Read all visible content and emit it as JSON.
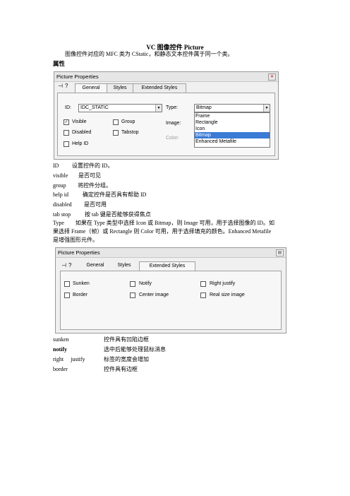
{
  "doc": {
    "title": "VC 图像控件 Picture",
    "intro": "图像控件对应的 MFC 类为 CStatic，和静态文本控件属于同一个类。",
    "section_heading": "属性"
  },
  "dialog1": {
    "title": "Picture Properties",
    "tabs": [
      "General",
      "Styles",
      "Extended Styles"
    ],
    "id_label": "ID:",
    "id_value": "IDC_STATIC",
    "type_label": "Type:",
    "type_value": "Bitmap",
    "type_options": [
      "Frame",
      "Rectangle",
      "Icon",
      "Bitmap",
      "Enhanced Metafile"
    ],
    "type_selected": "Bitmap",
    "image_label": "Image:",
    "color_label": "Color:",
    "checkboxes": {
      "visible": {
        "label": "Visible",
        "checked": true
      },
      "group": {
        "label": "Group",
        "checked": false
      },
      "disabled": {
        "label": "Disabled",
        "checked": false
      },
      "tabstop": {
        "label": "Tabstop",
        "checked": false
      },
      "help_id": {
        "label": "Help ID",
        "checked": false
      }
    }
  },
  "defs1": [
    {
      "term": "ID",
      "desc": "设置控件的 ID。"
    },
    {
      "term": "visible",
      "desc": "是否可见"
    },
    {
      "term": "group",
      "desc": "将控件分组。"
    },
    {
      "term": "help id",
      "desc": "确定控件是否具有帮助 ID"
    },
    {
      "term": "disabled",
      "desc": "是否可用"
    },
    {
      "term": "tab stop",
      "desc": "按 tab 键是否能够获得焦点"
    }
  ],
  "type_para": {
    "line1": "Type　　如果在 Type 类型中选择 Icon 或 Bitmap，则 Image 可用，用于选择图像的 ID。如",
    "line2": "果选择 Frame（帧）或 Rectangle 则 Color 可用，用于选择填充的颜色。Enhanced Metafile",
    "line3": "是增强图形元件。"
  },
  "dialog2": {
    "title": "Picture Properties",
    "tabs": [
      "General",
      "Styles",
      "Extended Styles"
    ],
    "checkboxes": {
      "sunken": {
        "label": "Sunken",
        "checked": false
      },
      "notify": {
        "label": "Notify",
        "checked": false
      },
      "right_justify": {
        "label": "Right justify",
        "checked": false
      },
      "border": {
        "label": "Border",
        "checked": false
      },
      "center_image": {
        "label": "Center image",
        "checked": false
      },
      "real_size_image": {
        "label": "Real size image",
        "checked": false
      }
    }
  },
  "defs2": [
    {
      "term": "sunken",
      "desc": "控件具有凹陷边框"
    },
    {
      "term": "notify",
      "desc": "选中后能够处理鼠标消息"
    },
    {
      "term": "right　 justify",
      "desc": "标签的宽度会增加"
    },
    {
      "term": "border",
      "desc": "控件具有边框"
    }
  ]
}
